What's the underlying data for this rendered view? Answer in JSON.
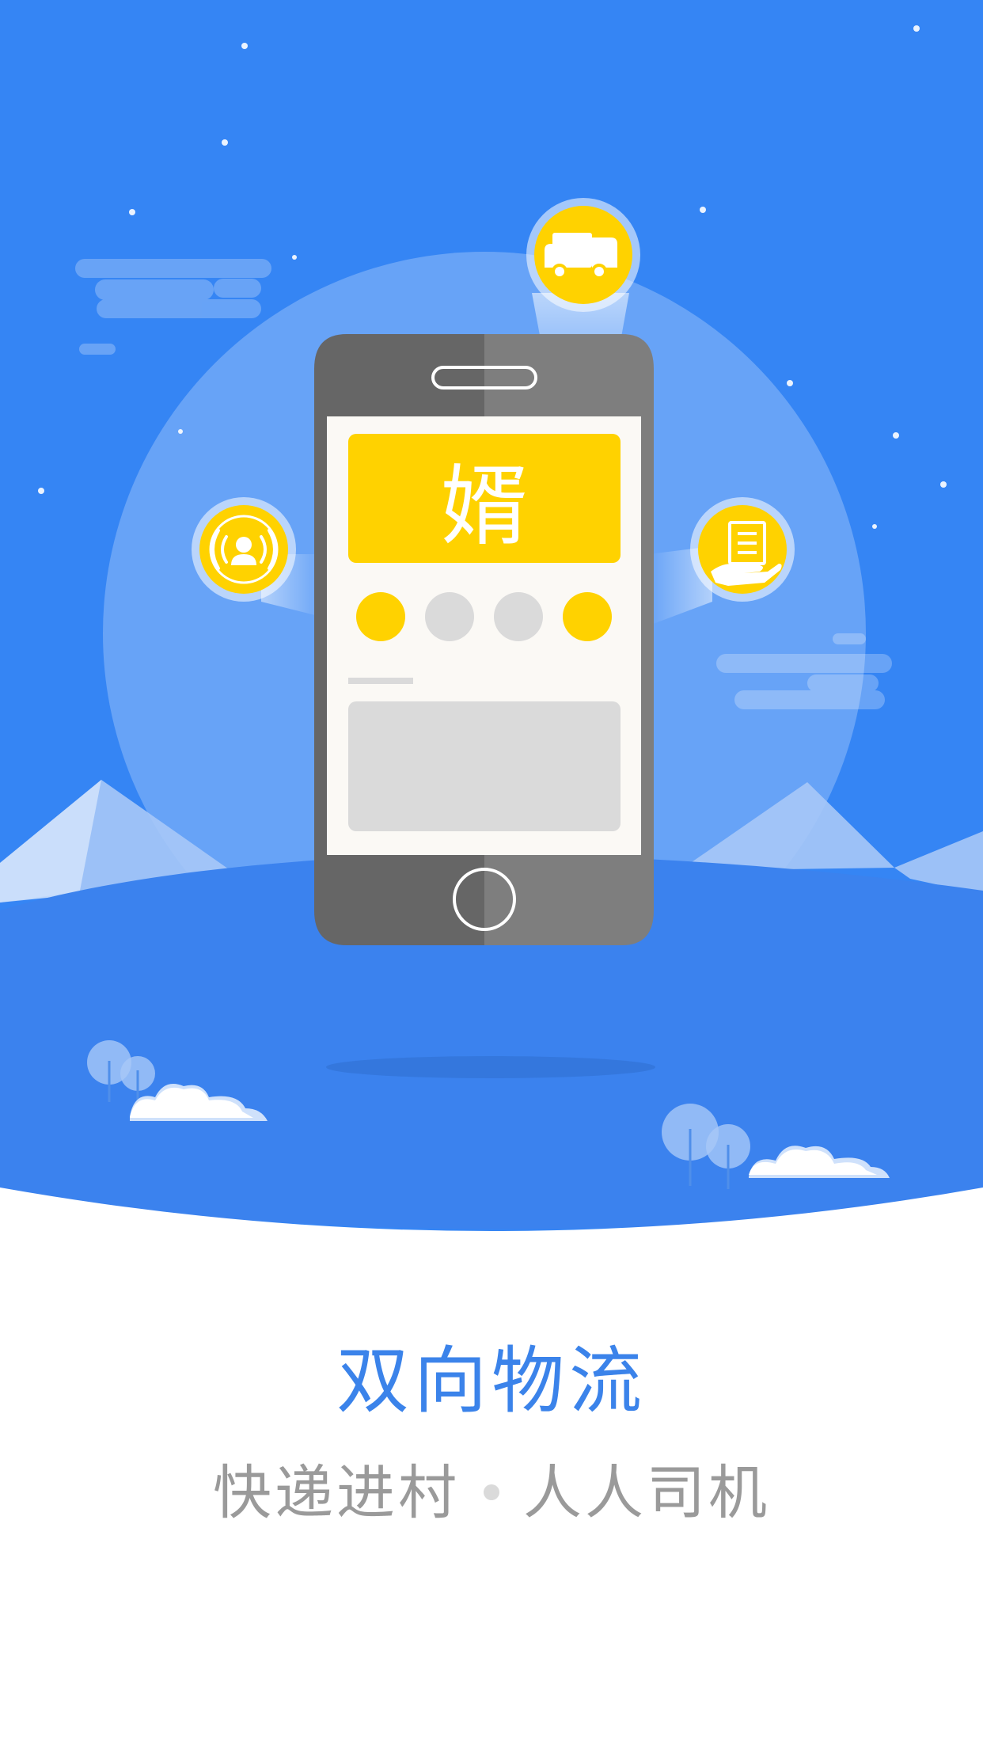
{
  "splash": {
    "title": "双向物流",
    "subtitle_left": "快递进村",
    "subtitle_right": "人人司机",
    "phone_banner_glyph": "婿"
  },
  "colors": {
    "sky": "#3585F4",
    "hill": "#3B82EE",
    "accent_yellow": "#FFD200",
    "title_blue": "#3B83EA",
    "subtitle_gray": "#9A9A9A",
    "dot_gray": "#DADADA",
    "phone_dark": "#666666",
    "phone_light": "#7E7E7E"
  },
  "icons": {
    "top": "delivery-truck-icon",
    "left": "courier-signal-icon",
    "right": "parcel-in-hand-icon"
  }
}
